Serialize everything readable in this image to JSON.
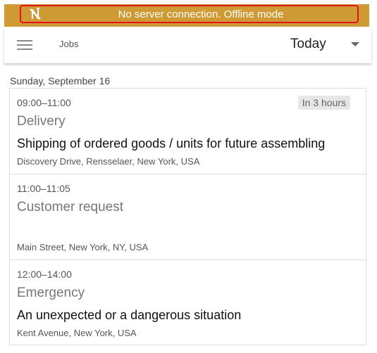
{
  "banner": {
    "text": "No server connection. Offline mode",
    "icon": "no-connection-icon",
    "background": "#cf9a34",
    "outline_color": "#e0141a"
  },
  "toolbar": {
    "menu_icon": "hamburger-menu-icon",
    "title": "Jobs",
    "date_filter": {
      "selected": "Today",
      "arrow_icon": "dropdown-arrow-icon"
    }
  },
  "day": {
    "label": "Sunday, September 16"
  },
  "jobs": [
    {
      "time": "09:00–11:00",
      "badge": "In 3 hours",
      "type": "Delivery",
      "description": "Shipping of ordered goods / units for future assembling",
      "address": "Discovery Drive, Rensselaer, New York, USA"
    },
    {
      "time": "11:00–11:05",
      "badge": "",
      "type": "Customer request",
      "description": "",
      "address": "Main Street, New York, NY, USA"
    },
    {
      "time": "12:00–14:00",
      "badge": "",
      "type": "Emergency",
      "description": "An unexpected or a dangerous situation",
      "address": "Kent Avenue, New York, USA"
    }
  ]
}
